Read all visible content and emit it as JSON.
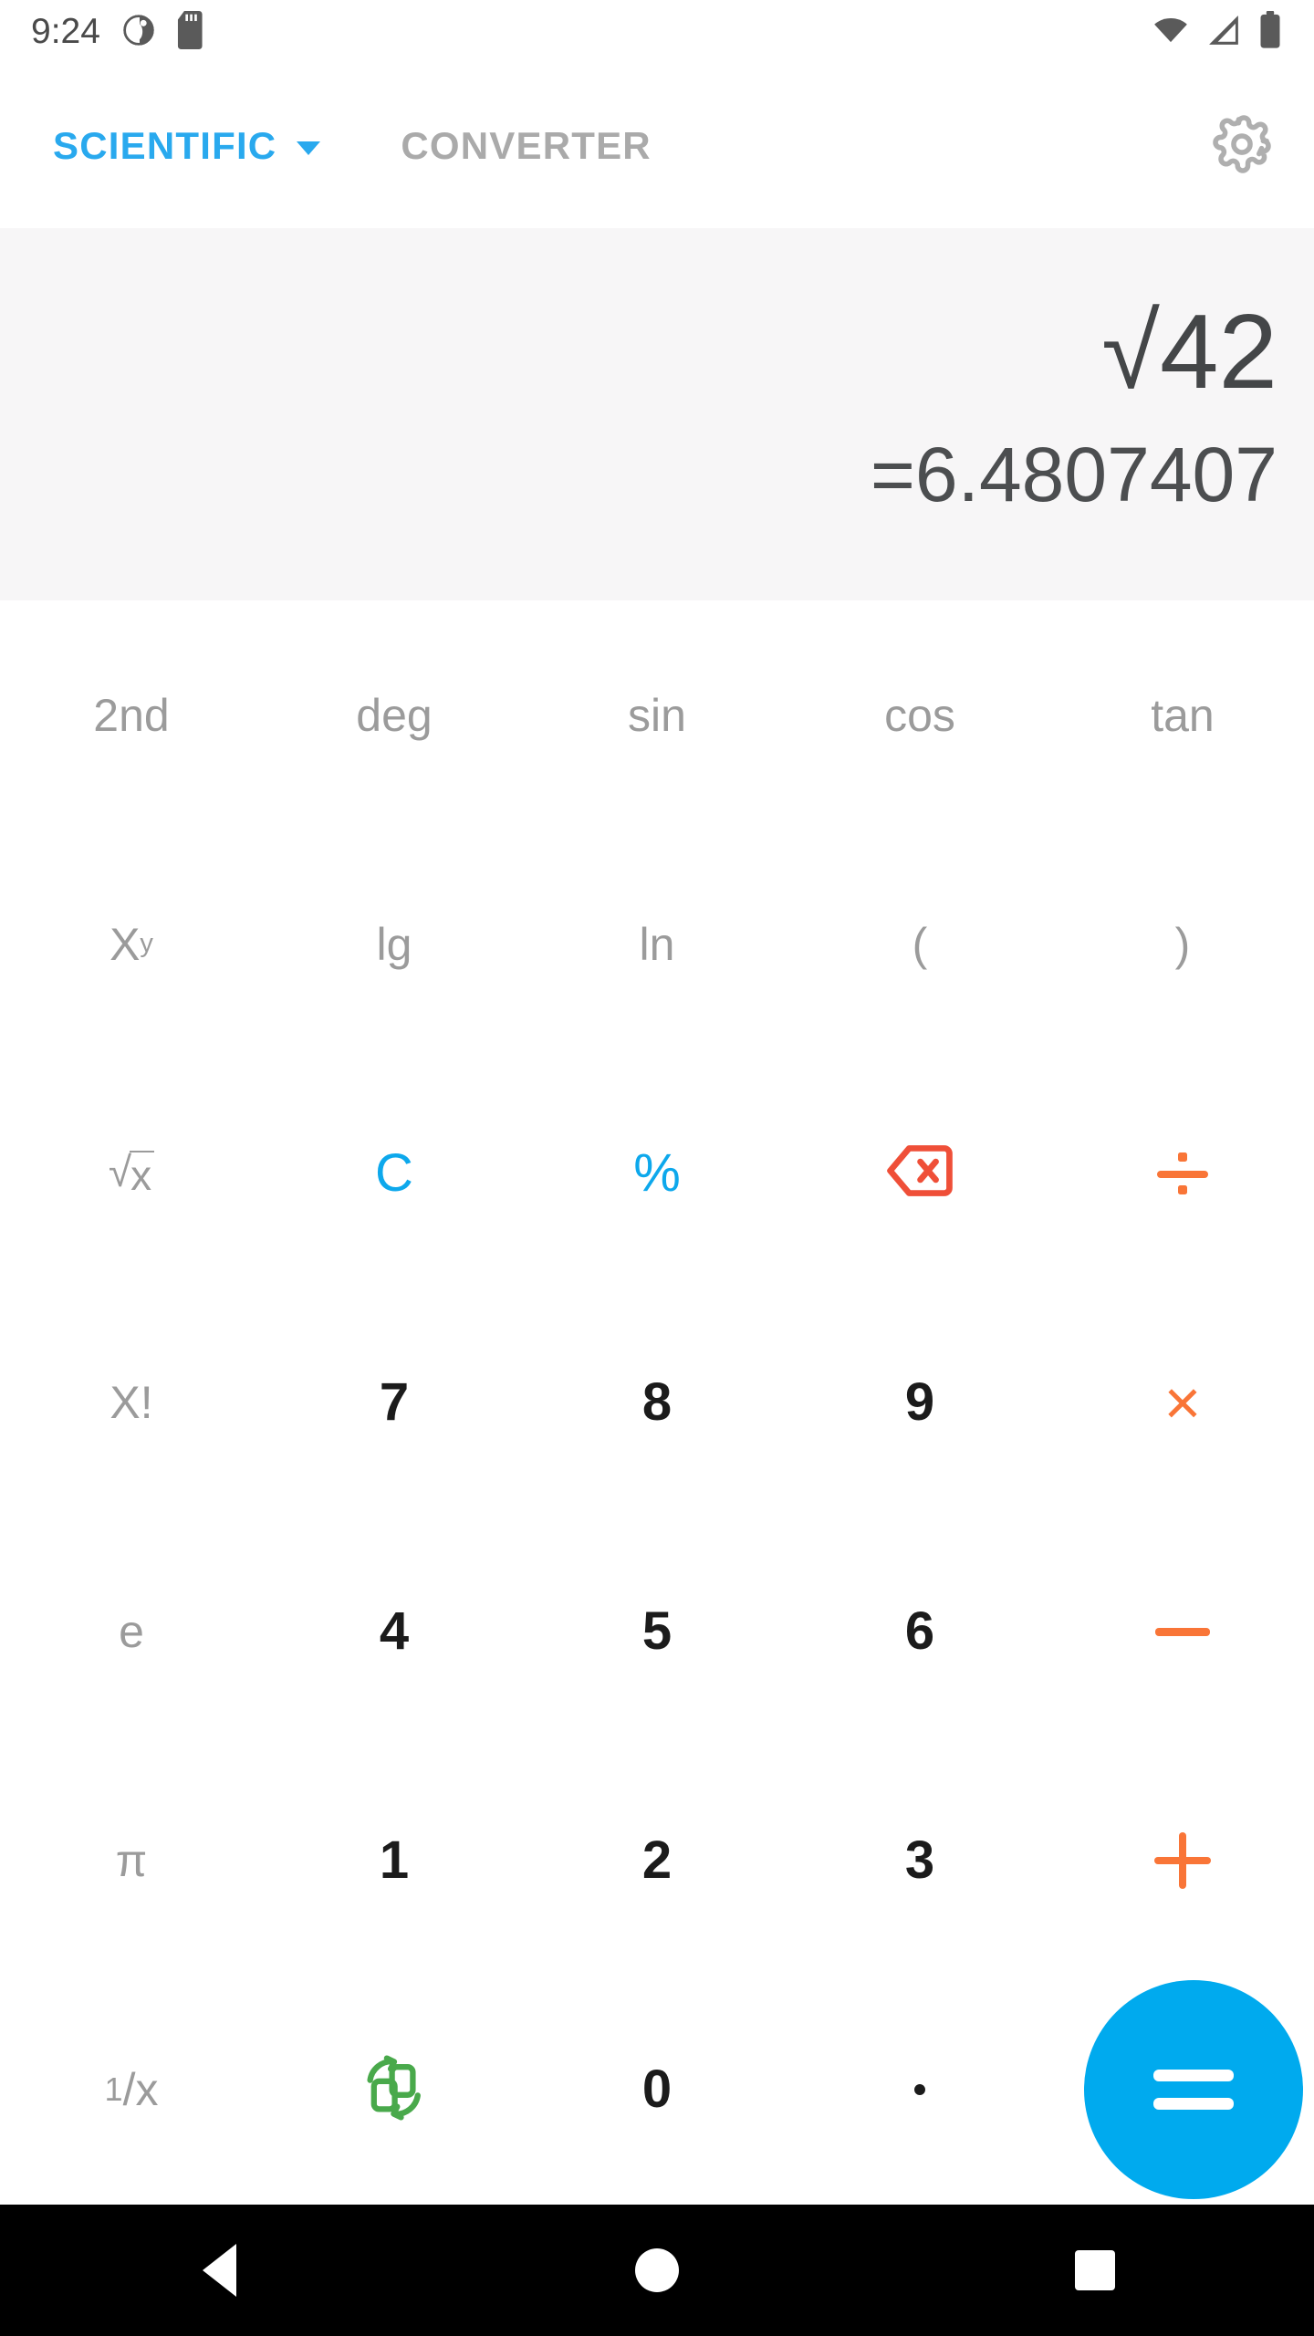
{
  "status_bar": {
    "time": "9:24",
    "left_icons": [
      "do-not-disturb-icon",
      "sd-card-icon"
    ],
    "right_icons": [
      "wifi-icon",
      "cellular-signal-icon",
      "battery-icon"
    ]
  },
  "tabs": {
    "scientific": {
      "label": "SCIENTIFIC",
      "active": true,
      "color": "#29A9EE",
      "has_dropdown": true
    },
    "converter": {
      "label": "CONVERTER",
      "active": false,
      "color": "#AAAAAA"
    },
    "settings_icon": "gear-icon"
  },
  "display": {
    "expression": "√42",
    "result": "=6.4807407",
    "background": "#F7F6F7"
  },
  "colors": {
    "accent_blue": "#0DA8EC",
    "fab_blue": "#00AAEE",
    "operator_orange": "#F97537",
    "delete_red": "#EF4F38",
    "swap_green": "#49A94B",
    "function_gray": "#9B9B9B",
    "number_black": "#1B1B1B"
  },
  "keypad": {
    "rows": [
      [
        {
          "name": "second-function",
          "label": "2nd",
          "style": "fn"
        },
        {
          "name": "angle-unit-deg",
          "label": "deg",
          "style": "fn"
        },
        {
          "name": "sine",
          "label": "sin",
          "style": "fn"
        },
        {
          "name": "cosine",
          "label": "cos",
          "style": "fn"
        },
        {
          "name": "tangent",
          "label": "tan",
          "style": "fn"
        }
      ],
      [
        {
          "name": "power-x-y",
          "label": "X",
          "sup": "y",
          "style": "fn"
        },
        {
          "name": "log-base-10",
          "label": "lg",
          "style": "fn"
        },
        {
          "name": "natural-log",
          "label": "ln",
          "style": "fn"
        },
        {
          "name": "open-parenthesis",
          "label": "(",
          "style": "fn"
        },
        {
          "name": "close-parenthesis",
          "label": ")",
          "style": "fn"
        }
      ],
      [
        {
          "name": "square-root",
          "label": "√x",
          "style": "sqrt"
        },
        {
          "name": "clear",
          "label": "C",
          "style": "blue"
        },
        {
          "name": "percent",
          "label": "%",
          "style": "blue"
        },
        {
          "name": "backspace",
          "label": "",
          "style": "icon-backspace"
        },
        {
          "name": "divide",
          "label": "÷",
          "style": "icon-divide"
        }
      ],
      [
        {
          "name": "factorial",
          "label": "X!",
          "style": "fn"
        },
        {
          "name": "digit-7",
          "label": "7",
          "style": "num"
        },
        {
          "name": "digit-8",
          "label": "8",
          "style": "num"
        },
        {
          "name": "digit-9",
          "label": "9",
          "style": "num"
        },
        {
          "name": "multiply",
          "label": "×",
          "style": "icon-times"
        }
      ],
      [
        {
          "name": "euler-e",
          "label": "e",
          "style": "fn"
        },
        {
          "name": "digit-4",
          "label": "4",
          "style": "num"
        },
        {
          "name": "digit-5",
          "label": "5",
          "style": "num"
        },
        {
          "name": "digit-6",
          "label": "6",
          "style": "num"
        },
        {
          "name": "subtract",
          "label": "−",
          "style": "icon-minus"
        }
      ],
      [
        {
          "name": "pi",
          "label": "π",
          "style": "fn"
        },
        {
          "name": "digit-1",
          "label": "1",
          "style": "num"
        },
        {
          "name": "digit-2",
          "label": "2",
          "style": "num"
        },
        {
          "name": "digit-3",
          "label": "3",
          "style": "num"
        },
        {
          "name": "add",
          "label": "+",
          "style": "icon-plus"
        }
      ],
      [
        {
          "name": "reciprocal",
          "label": "1/x",
          "style": "reciprocal"
        },
        {
          "name": "swap-units",
          "label": "",
          "style": "icon-swap"
        },
        {
          "name": "digit-0",
          "label": "0",
          "style": "num"
        },
        {
          "name": "decimal-point",
          "label": ".",
          "style": "icon-dot"
        },
        {
          "name": "equals",
          "label": "=",
          "style": "fab"
        }
      ]
    ]
  },
  "nav_bar": {
    "back": "back-icon",
    "home": "home-icon",
    "recents": "recents-icon"
  }
}
